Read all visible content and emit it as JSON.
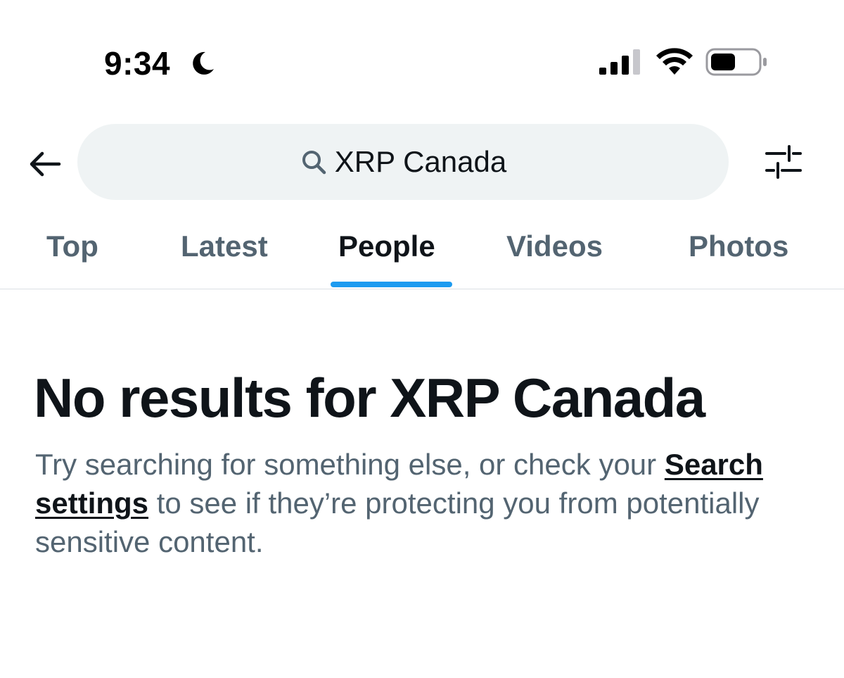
{
  "status_bar": {
    "time": "9:34"
  },
  "search": {
    "query": "XRP Canada"
  },
  "tabs": [
    {
      "label": "Top",
      "active": false
    },
    {
      "label": "Latest",
      "active": false
    },
    {
      "label": "People",
      "active": true
    },
    {
      "label": "Videos",
      "active": false
    },
    {
      "label": "Photos",
      "active": false
    }
  ],
  "empty_state": {
    "title": "No results for XRP Canada",
    "body_before_link": "Try searching for something else, or check your ",
    "link_label": "Search settings",
    "body_after_link": " to see if they’re protecting you from potentially sensitive content."
  },
  "colors": {
    "accent": "#1d9bf0",
    "primary_text": "#0f1419",
    "secondary_text": "#536471",
    "search_bg": "#eff3f4"
  },
  "icons": {
    "moon": "moon-icon",
    "signal": "cellular-signal-icon",
    "wifi": "wifi-icon",
    "battery": "battery-icon",
    "back": "arrow-left-icon",
    "search": "search-icon",
    "filter": "sliders-icon"
  }
}
